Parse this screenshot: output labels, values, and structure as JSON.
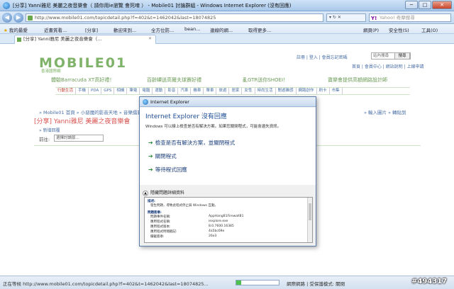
{
  "window": {
    "title": "[分享] Yanni雅尼 美麗之夜音樂會（ 請你用ie瀏覽 會死唷 ） - Mobile01 討論群組 - Windows Internet Explorer (沒有回應)",
    "minimize": "─",
    "maximize": "□",
    "close": "✕"
  },
  "address": {
    "url": "http://www.mobile01.com/topicdetail.php?f=402&t=1462042&last=18074825",
    "actions": "▾ ↻ ✕",
    "search_placeholder": "Yahoo! 奇摩搜尋"
  },
  "favorites": {
    "label": "我的最愛",
    "items": [
      "近畫質看...",
      "[分享]",
      "歡迎來到...",
      "全方位防...",
      "bean...",
      "連線的網...",
      "取得更多..."
    ],
    "commands": [
      "網頁(P)",
      "安全性(S)",
      "工具(O)"
    ]
  },
  "tab": {
    "label": "[分享] Yanni雅尼 美麗之夜音樂會（..."
  },
  "page": {
    "logo": "MOBILE01",
    "logo_sub": "香港國際網",
    "login_links": "註冊 | 登入 | 會員忘記密碼",
    "site_search_placeholder": "站內搜尋",
    "site_search_button": "搜尋",
    "site_nav": "首頁 | 會員中心 | 網站說明 | 上線申請",
    "ads": [
      "體驗Barracuda XT高好禮！",
      "百齡罈送高爾夫球賽好禮",
      "亂GTR送你SHOEI！",
      "寶樂會提供高額網路設計師"
    ],
    "categories": [
      "行動生活",
      "手機",
      "PDA",
      "GPS",
      "相機",
      "筆電",
      "電腦",
      "運動",
      "影音",
      "汽車",
      "機車",
      "單車",
      "旅遊",
      "居家",
      "女性",
      "時尚生活",
      "閒遊雜感",
      "網路創作",
      "刷卡",
      "市集"
    ],
    "breadcrumb": "» Mobile01 首頁 » 小惡魔的影音天地 » 音樂擂臺",
    "topic_title": "[分享] Yanni雅尼 美麗之夜音樂會",
    "new_topic": "» 新增回覆",
    "goto_label": "前往:",
    "goto_select": "選擇討論版...",
    "right_links": "» 輸入圖片 » 轉貼到"
  },
  "dialog": {
    "title": "Internet Explorer",
    "heading": "Internet Explorer 沒有回應",
    "description": "Windows 可以線上檢查是否有解決方案。如果您關閉程式，可能會遺失資訊。",
    "options": [
      "檢查是否有解決方案，並關閉程式",
      "關閉程式",
      "等待程式回應"
    ],
    "detail_toggle": "隱藏問題詳細資料",
    "details": {
      "desc_head": "描述:",
      "desc_text": "發生問題，導致此程式停止與 Windows 互動。",
      "sig_head": "問題簽章:",
      "rows": [
        {
          "label": "問題事件名稱:",
          "value": "AppHangB1FirewallB1"
        },
        {
          "label": "應用程式名稱:",
          "value": "iexplore.exe"
        },
        {
          "label": "應用程式版本:",
          "value": "8.0.7600.16385"
        },
        {
          "label": "應用程式時間戳記:",
          "value": "4a5bc69e"
        },
        {
          "label": "攔截簽章:",
          "value": "26e3"
        }
      ]
    }
  },
  "status": {
    "text": "正在等候 http://www.mobile01.com/topicdetail.php?f=402&t=1462042&last=18074825...",
    "progress": 0.12,
    "zone": "網際網路 | 受保護模式: 關閉",
    "watermark": "#494317"
  },
  "colors": {
    "accent": "#7fb369",
    "link": "#4a6fa5",
    "title_red": "#d9534f",
    "dialog_heading": "#1e4e95"
  }
}
